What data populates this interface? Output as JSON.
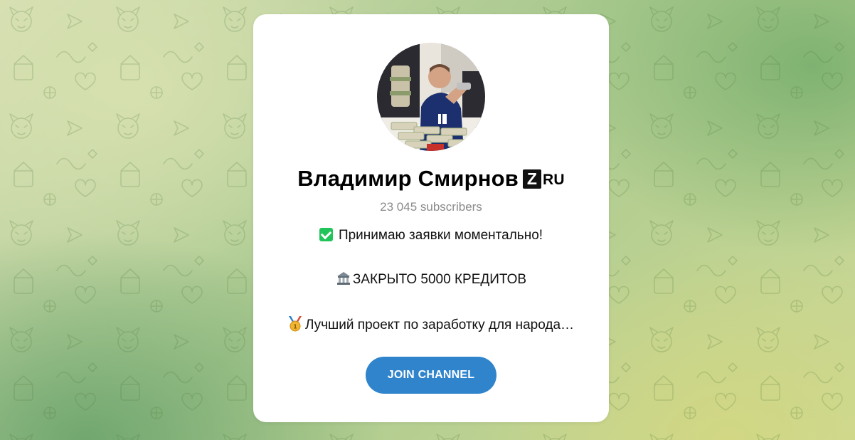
{
  "channel": {
    "name": "Владимир Смирнов",
    "badge_letter": "Z",
    "badge_suffix": "RU",
    "subscribers": "23 045 subscribers",
    "description": [
      {
        "icon": "check-mark-icon",
        "text": "Принимаю заявки моментально!"
      },
      {
        "icon": "bank-icon",
        "text": "ЗАКРЫТО 5000 КРЕДИТОВ"
      },
      {
        "icon": "medal-icon",
        "text": "Лучший проект по заработку для народа…"
      }
    ]
  },
  "actions": {
    "join_label": "JOIN CHANNEL"
  },
  "colors": {
    "button": "#2f84cc",
    "check": "#21c45a",
    "subscribers_text": "#8a8a8a"
  }
}
